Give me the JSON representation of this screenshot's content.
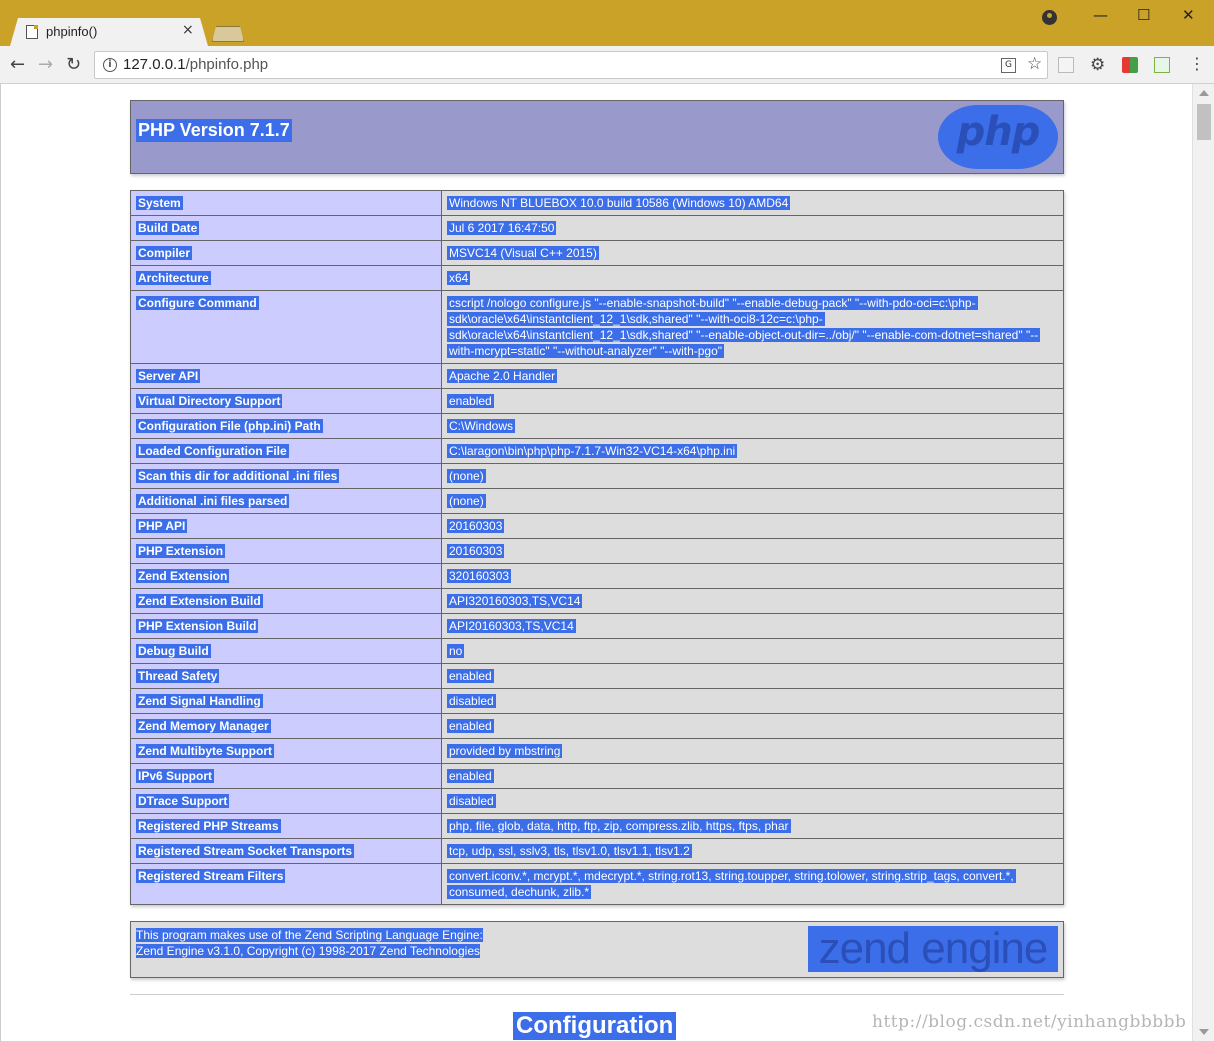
{
  "browser": {
    "tab_title": "phpinfo()",
    "tab_close": "×",
    "url_host": "127.0.0.1",
    "url_path": "/phpinfo.php",
    "window_controls": [
      "—",
      "☐",
      "✕"
    ],
    "colors": {
      "titlebar": "#c9a227",
      "selection": "#3b6ee8"
    }
  },
  "header": {
    "title": "PHP Version 7.1.7",
    "logo_text": "php"
  },
  "info_rows": [
    {
      "key": "System",
      "value": "Windows NT BLUEBOX 10.0 build 10586 (Windows 10) AMD64"
    },
    {
      "key": "Build Date",
      "value": "Jul 6 2017 16:47:50"
    },
    {
      "key": "Compiler",
      "value": "MSVC14 (Visual C++ 2015)"
    },
    {
      "key": "Architecture",
      "value": "x64"
    },
    {
      "key": "Configure Command",
      "value": "cscript /nologo configure.js \"--enable-snapshot-build\" \"--enable-debug-pack\" \"--with-pdo-oci=c:\\php-sdk\\oracle\\x64\\instantclient_12_1\\sdk,shared\" \"--with-oci8-12c=c:\\php-sdk\\oracle\\x64\\instantclient_12_1\\sdk,shared\" \"--enable-object-out-dir=../obj/\" \"--enable-com-dotnet=shared\" \"--with-mcrypt=static\" \"--without-analyzer\" \"--with-pgo\""
    },
    {
      "key": "Server API",
      "value": "Apache 2.0 Handler"
    },
    {
      "key": "Virtual Directory Support",
      "value": "enabled"
    },
    {
      "key": "Configuration File (php.ini) Path",
      "value": "C:\\Windows"
    },
    {
      "key": "Loaded Configuration File",
      "value": "C:\\laragon\\bin\\php\\php-7.1.7-Win32-VC14-x64\\php.ini"
    },
    {
      "key": "Scan this dir for additional .ini files",
      "value": "(none)"
    },
    {
      "key": "Additional .ini files parsed",
      "value": "(none)"
    },
    {
      "key": "PHP API",
      "value": "20160303"
    },
    {
      "key": "PHP Extension",
      "value": "20160303"
    },
    {
      "key": "Zend Extension",
      "value": "320160303"
    },
    {
      "key": "Zend Extension Build",
      "value": "API320160303,TS,VC14"
    },
    {
      "key": "PHP Extension Build",
      "value": "API20160303,TS,VC14"
    },
    {
      "key": "Debug Build",
      "value": "no"
    },
    {
      "key": "Thread Safety",
      "value": "enabled"
    },
    {
      "key": "Zend Signal Handling",
      "value": "disabled"
    },
    {
      "key": "Zend Memory Manager",
      "value": "enabled"
    },
    {
      "key": "Zend Multibyte Support",
      "value": "provided by mbstring"
    },
    {
      "key": "IPv6 Support",
      "value": "enabled"
    },
    {
      "key": "DTrace Support",
      "value": "disabled"
    },
    {
      "key": "Registered PHP Streams",
      "value": "php, file, glob, data, http, ftp, zip, compress.zlib, https, ftps, phar"
    },
    {
      "key": "Registered Stream Socket Transports",
      "value": "tcp, udp, ssl, sslv3, tls, tlsv1.0, tlsv1.1, tlsv1.2"
    },
    {
      "key": "Registered Stream Filters",
      "value": "convert.iconv.*, mcrypt.*, mdecrypt.*, string.rot13, string.toupper, string.tolower, string.strip_tags, convert.*, consumed, dechunk, zlib.*"
    }
  ],
  "zend": {
    "line1": "This program makes use of the Zend Scripting Language Engine:",
    "line2": "Zend Engine v3.1.0, Copyright (c) 1998-2017 Zend Technologies",
    "logo_text": "zend engine"
  },
  "section_heading": "Configuration",
  "watermark": "http://blog.csdn.net/yinhangbbbbb"
}
